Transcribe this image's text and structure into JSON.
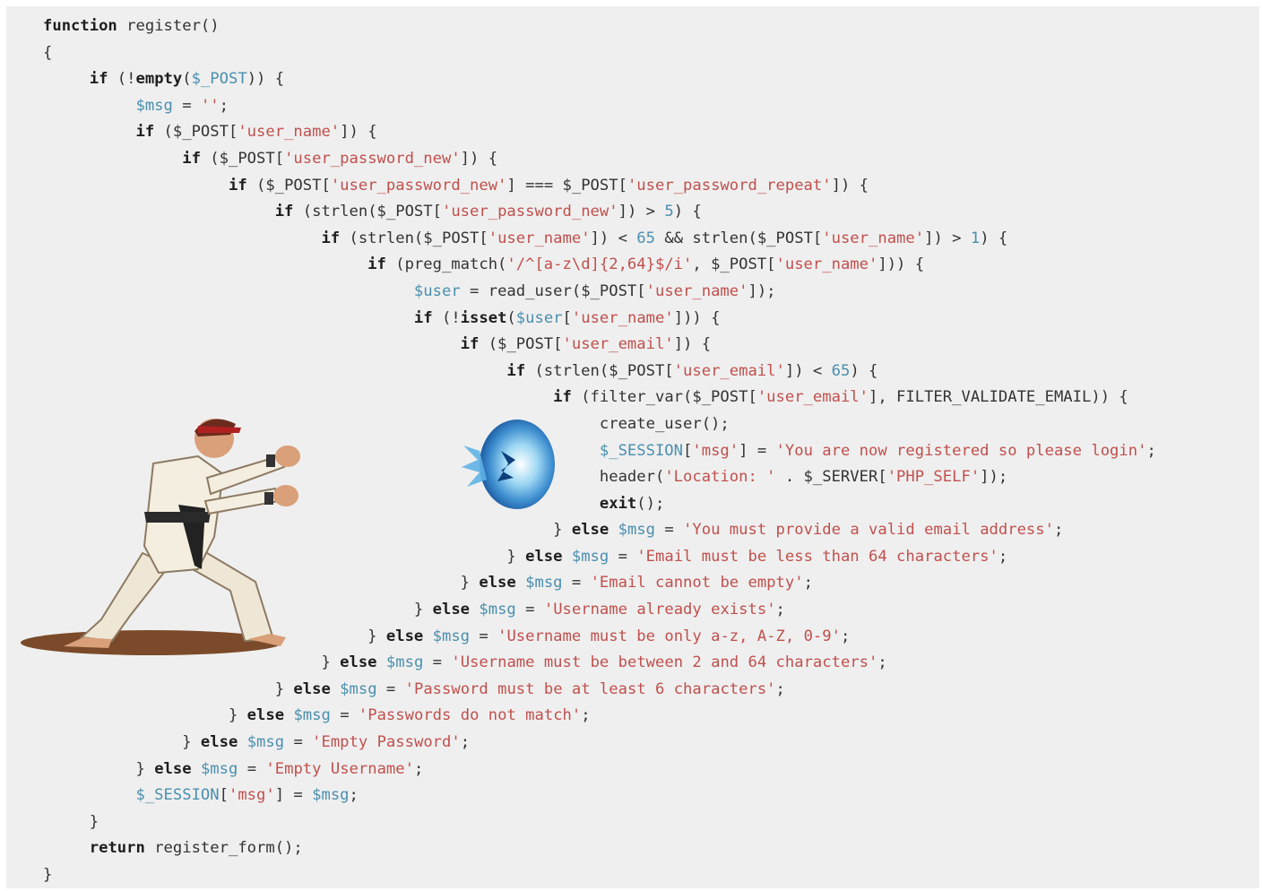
{
  "colors": {
    "background": "#efefef",
    "keyword": "#1e1e1e",
    "plain": "#333333",
    "variable": "#4a8fae",
    "string": "#c0504d"
  },
  "illustration": {
    "fighter": "martial-artist-fighter-illustration",
    "projectile": "blue-energy-fireball-illustration"
  },
  "code_lines": [
    {
      "indent": 0,
      "tokens": [
        {
          "t": "keyword",
          "v": "function"
        },
        {
          "t": "plain",
          "v": " register()"
        }
      ]
    },
    {
      "indent": 0,
      "tokens": [
        {
          "t": "plain",
          "v": "{"
        }
      ]
    },
    {
      "indent": 1,
      "tokens": [
        {
          "t": "keyword",
          "v": "if"
        },
        {
          "t": "plain",
          "v": " (!"
        },
        {
          "t": "keyword",
          "v": "empty"
        },
        {
          "t": "plain",
          "v": "("
        },
        {
          "t": "variable",
          "v": "$_POST"
        },
        {
          "t": "plain",
          "v": ")) {"
        }
      ]
    },
    {
      "indent": 2,
      "tokens": [
        {
          "t": "variable",
          "v": "$msg"
        },
        {
          "t": "plain",
          "v": " = "
        },
        {
          "t": "string",
          "v": "''"
        },
        {
          "t": "plain",
          "v": ";"
        }
      ]
    },
    {
      "indent": 2,
      "tokens": [
        {
          "t": "keyword",
          "v": "if"
        },
        {
          "t": "plain",
          "v": " ($_POST["
        },
        {
          "t": "string",
          "v": "'user_name'"
        },
        {
          "t": "plain",
          "v": "]) {"
        }
      ]
    },
    {
      "indent": 3,
      "tokens": [
        {
          "t": "keyword",
          "v": "if"
        },
        {
          "t": "plain",
          "v": " ($_POST["
        },
        {
          "t": "string",
          "v": "'user_password_new'"
        },
        {
          "t": "plain",
          "v": "]) {"
        }
      ]
    },
    {
      "indent": 4,
      "tokens": [
        {
          "t": "keyword",
          "v": "if"
        },
        {
          "t": "plain",
          "v": " ($_POST["
        },
        {
          "t": "string",
          "v": "'user_password_new'"
        },
        {
          "t": "plain",
          "v": "] === $_POST["
        },
        {
          "t": "string",
          "v": "'user_password_repeat'"
        },
        {
          "t": "plain",
          "v": "]) {"
        }
      ]
    },
    {
      "indent": 5,
      "tokens": [
        {
          "t": "keyword",
          "v": "if"
        },
        {
          "t": "plain",
          "v": " (strlen($_POST["
        },
        {
          "t": "string",
          "v": "'user_password_new'"
        },
        {
          "t": "plain",
          "v": "]) > "
        },
        {
          "t": "variable",
          "v": "5"
        },
        {
          "t": "plain",
          "v": ") {"
        }
      ]
    },
    {
      "indent": 6,
      "tokens": [
        {
          "t": "keyword",
          "v": "if"
        },
        {
          "t": "plain",
          "v": " (strlen($_POST["
        },
        {
          "t": "string",
          "v": "'user_name'"
        },
        {
          "t": "plain",
          "v": "]) < "
        },
        {
          "t": "variable",
          "v": "65"
        },
        {
          "t": "plain",
          "v": " && strlen($_POST["
        },
        {
          "t": "string",
          "v": "'user_name'"
        },
        {
          "t": "plain",
          "v": "]) > "
        },
        {
          "t": "variable",
          "v": "1"
        },
        {
          "t": "plain",
          "v": ") {"
        }
      ]
    },
    {
      "indent": 7,
      "tokens": [
        {
          "t": "keyword",
          "v": "if"
        },
        {
          "t": "plain",
          "v": " (preg_match("
        },
        {
          "t": "string",
          "v": "'/^[a-z\\d]{2,64}$/i'"
        },
        {
          "t": "plain",
          "v": ", $_POST["
        },
        {
          "t": "string",
          "v": "'user_name'"
        },
        {
          "t": "plain",
          "v": "])) {"
        }
      ]
    },
    {
      "indent": 8,
      "tokens": [
        {
          "t": "variable",
          "v": "$user"
        },
        {
          "t": "plain",
          "v": " = read_user($_POST["
        },
        {
          "t": "string",
          "v": "'user_name'"
        },
        {
          "t": "plain",
          "v": "]);"
        }
      ]
    },
    {
      "indent": 8,
      "tokens": [
        {
          "t": "keyword",
          "v": "if"
        },
        {
          "t": "plain",
          "v": " (!"
        },
        {
          "t": "keyword",
          "v": "isset"
        },
        {
          "t": "plain",
          "v": "("
        },
        {
          "t": "variable",
          "v": "$user"
        },
        {
          "t": "plain",
          "v": "["
        },
        {
          "t": "string",
          "v": "'user_name'"
        },
        {
          "t": "plain",
          "v": "])) {"
        }
      ]
    },
    {
      "indent": 9,
      "tokens": [
        {
          "t": "keyword",
          "v": "if"
        },
        {
          "t": "plain",
          "v": " ($_POST["
        },
        {
          "t": "string",
          "v": "'user_email'"
        },
        {
          "t": "plain",
          "v": "]) {"
        }
      ]
    },
    {
      "indent": 10,
      "tokens": [
        {
          "t": "keyword",
          "v": "if"
        },
        {
          "t": "plain",
          "v": " (strlen($_POST["
        },
        {
          "t": "string",
          "v": "'user_email'"
        },
        {
          "t": "plain",
          "v": "]) < "
        },
        {
          "t": "variable",
          "v": "65"
        },
        {
          "t": "plain",
          "v": ") {"
        }
      ]
    },
    {
      "indent": 11,
      "tokens": [
        {
          "t": "keyword",
          "v": "if"
        },
        {
          "t": "plain",
          "v": " (filter_var($_POST["
        },
        {
          "t": "string",
          "v": "'user_email'"
        },
        {
          "t": "plain",
          "v": "], FILTER_VALIDATE_EMAIL)) {"
        }
      ]
    },
    {
      "indent": 12,
      "tokens": [
        {
          "t": "plain",
          "v": "create_user();"
        }
      ]
    },
    {
      "indent": 12,
      "tokens": [
        {
          "t": "variable",
          "v": "$_SESSION"
        },
        {
          "t": "plain",
          "v": "["
        },
        {
          "t": "string",
          "v": "'msg'"
        },
        {
          "t": "plain",
          "v": "] = "
        },
        {
          "t": "string",
          "v": "'You are now registered so please login'"
        },
        {
          "t": "plain",
          "v": ";"
        }
      ]
    },
    {
      "indent": 12,
      "tokens": [
        {
          "t": "plain",
          "v": "header("
        },
        {
          "t": "string",
          "v": "'Location: '"
        },
        {
          "t": "plain",
          "v": " . $_SERVER["
        },
        {
          "t": "string",
          "v": "'PHP_SELF'"
        },
        {
          "t": "plain",
          "v": "]);"
        }
      ]
    },
    {
      "indent": 12,
      "tokens": [
        {
          "t": "keyword",
          "v": "exit"
        },
        {
          "t": "plain",
          "v": "();"
        }
      ]
    },
    {
      "indent": 11,
      "tokens": [
        {
          "t": "plain",
          "v": "} "
        },
        {
          "t": "keyword",
          "v": "else"
        },
        {
          "t": "plain",
          "v": " "
        },
        {
          "t": "variable",
          "v": "$msg"
        },
        {
          "t": "plain",
          "v": " = "
        },
        {
          "t": "string",
          "v": "'You must provide a valid email address'"
        },
        {
          "t": "plain",
          "v": ";"
        }
      ]
    },
    {
      "indent": 10,
      "tokens": [
        {
          "t": "plain",
          "v": "} "
        },
        {
          "t": "keyword",
          "v": "else"
        },
        {
          "t": "plain",
          "v": " "
        },
        {
          "t": "variable",
          "v": "$msg"
        },
        {
          "t": "plain",
          "v": " = "
        },
        {
          "t": "string",
          "v": "'Email must be less than 64 characters'"
        },
        {
          "t": "plain",
          "v": ";"
        }
      ]
    },
    {
      "indent": 9,
      "tokens": [
        {
          "t": "plain",
          "v": "} "
        },
        {
          "t": "keyword",
          "v": "else"
        },
        {
          "t": "plain",
          "v": " "
        },
        {
          "t": "variable",
          "v": "$msg"
        },
        {
          "t": "plain",
          "v": " = "
        },
        {
          "t": "string",
          "v": "'Email cannot be empty'"
        },
        {
          "t": "plain",
          "v": ";"
        }
      ]
    },
    {
      "indent": 8,
      "tokens": [
        {
          "t": "plain",
          "v": "} "
        },
        {
          "t": "keyword",
          "v": "else"
        },
        {
          "t": "plain",
          "v": " "
        },
        {
          "t": "variable",
          "v": "$msg"
        },
        {
          "t": "plain",
          "v": " = "
        },
        {
          "t": "string",
          "v": "'Username already exists'"
        },
        {
          "t": "plain",
          "v": ";"
        }
      ]
    },
    {
      "indent": 7,
      "tokens": [
        {
          "t": "plain",
          "v": "} "
        },
        {
          "t": "keyword",
          "v": "else"
        },
        {
          "t": "plain",
          "v": " "
        },
        {
          "t": "variable",
          "v": "$msg"
        },
        {
          "t": "plain",
          "v": " = "
        },
        {
          "t": "string",
          "v": "'Username must be only a-z, A-Z, 0-9'"
        },
        {
          "t": "plain",
          "v": ";"
        }
      ]
    },
    {
      "indent": 6,
      "tokens": [
        {
          "t": "plain",
          "v": "} "
        },
        {
          "t": "keyword",
          "v": "else"
        },
        {
          "t": "plain",
          "v": " "
        },
        {
          "t": "variable",
          "v": "$msg"
        },
        {
          "t": "plain",
          "v": " = "
        },
        {
          "t": "string",
          "v": "'Username must be between 2 and 64 characters'"
        },
        {
          "t": "plain",
          "v": ";"
        }
      ]
    },
    {
      "indent": 5,
      "tokens": [
        {
          "t": "plain",
          "v": "} "
        },
        {
          "t": "keyword",
          "v": "else"
        },
        {
          "t": "plain",
          "v": " "
        },
        {
          "t": "variable",
          "v": "$msg"
        },
        {
          "t": "plain",
          "v": " = "
        },
        {
          "t": "string",
          "v": "'Password must be at least 6 characters'"
        },
        {
          "t": "plain",
          "v": ";"
        }
      ]
    },
    {
      "indent": 4,
      "tokens": [
        {
          "t": "plain",
          "v": "} "
        },
        {
          "t": "keyword",
          "v": "else"
        },
        {
          "t": "plain",
          "v": " "
        },
        {
          "t": "variable",
          "v": "$msg"
        },
        {
          "t": "plain",
          "v": " = "
        },
        {
          "t": "string",
          "v": "'Passwords do not match'"
        },
        {
          "t": "plain",
          "v": ";"
        }
      ]
    },
    {
      "indent": 3,
      "tokens": [
        {
          "t": "plain",
          "v": "} "
        },
        {
          "t": "keyword",
          "v": "else"
        },
        {
          "t": "plain",
          "v": " "
        },
        {
          "t": "variable",
          "v": "$msg"
        },
        {
          "t": "plain",
          "v": " = "
        },
        {
          "t": "string",
          "v": "'Empty Password'"
        },
        {
          "t": "plain",
          "v": ";"
        }
      ]
    },
    {
      "indent": 2,
      "tokens": [
        {
          "t": "plain",
          "v": "} "
        },
        {
          "t": "keyword",
          "v": "else"
        },
        {
          "t": "plain",
          "v": " "
        },
        {
          "t": "variable",
          "v": "$msg"
        },
        {
          "t": "plain",
          "v": " = "
        },
        {
          "t": "string",
          "v": "'Empty Username'"
        },
        {
          "t": "plain",
          "v": ";"
        }
      ]
    },
    {
      "indent": 2,
      "tokens": [
        {
          "t": "variable",
          "v": "$_SESSION"
        },
        {
          "t": "plain",
          "v": "["
        },
        {
          "t": "string",
          "v": "'msg'"
        },
        {
          "t": "plain",
          "v": "] = "
        },
        {
          "t": "variable",
          "v": "$msg"
        },
        {
          "t": "plain",
          "v": ";"
        }
      ]
    },
    {
      "indent": 1,
      "tokens": [
        {
          "t": "plain",
          "v": "}"
        }
      ]
    },
    {
      "indent": 1,
      "tokens": [
        {
          "t": "keyword",
          "v": "return"
        },
        {
          "t": "plain",
          "v": " register_form();"
        }
      ]
    },
    {
      "indent": 0,
      "tokens": [
        {
          "t": "plain",
          "v": "}"
        }
      ]
    }
  ]
}
